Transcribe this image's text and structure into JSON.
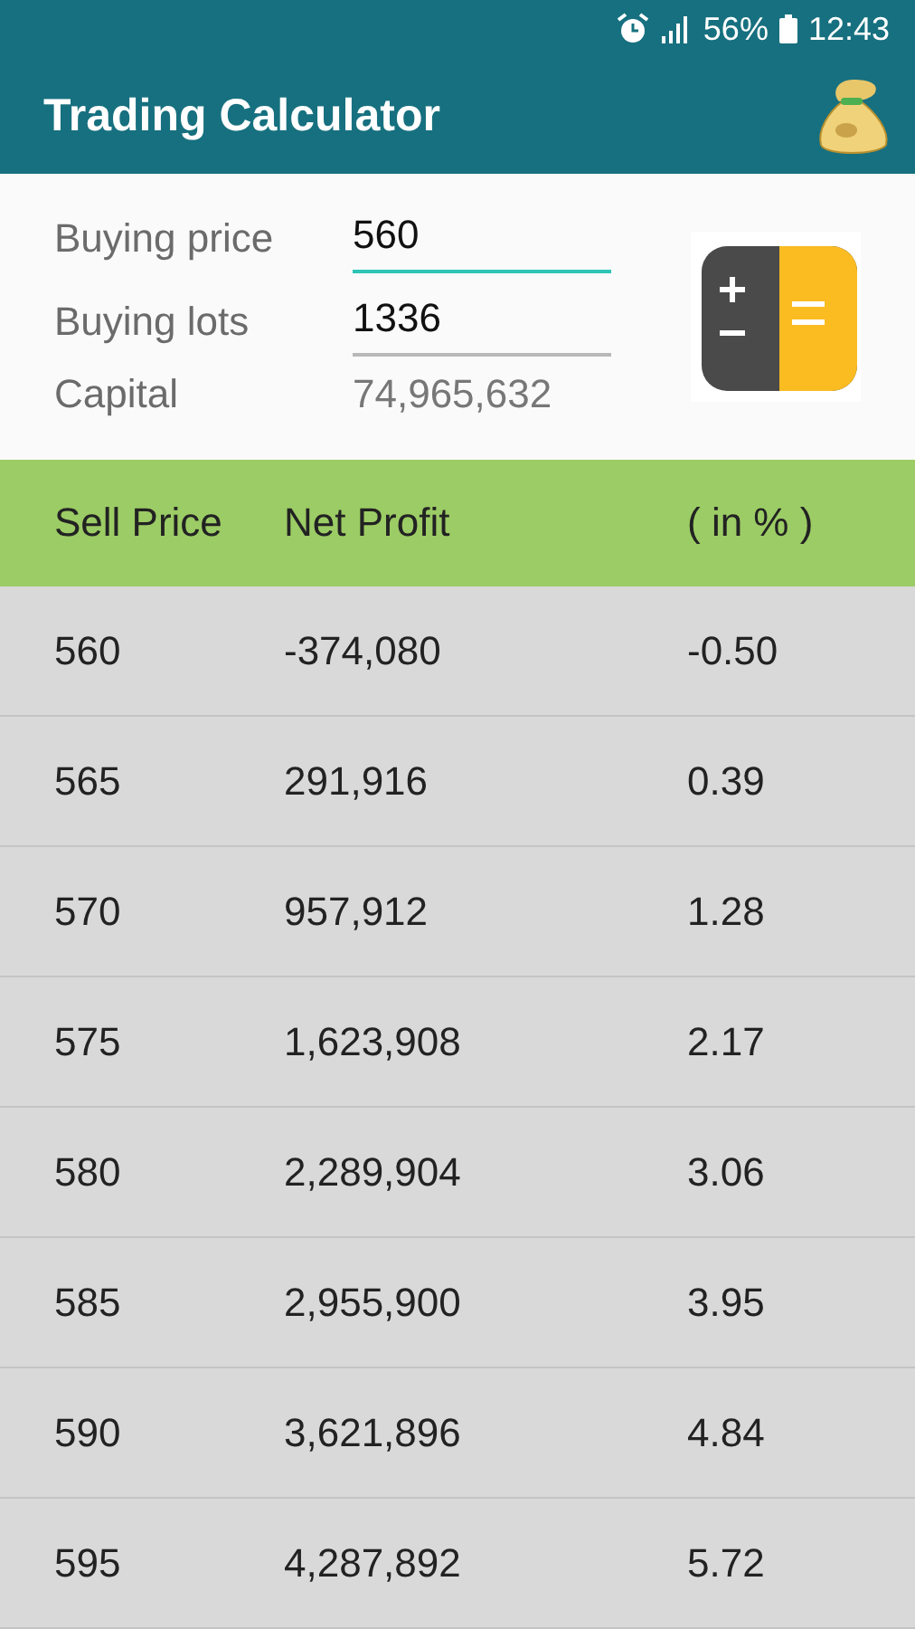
{
  "status_bar": {
    "battery": "56%",
    "time": "12:43"
  },
  "app_bar": {
    "title": "Trading Calculator"
  },
  "form": {
    "fields": [
      {
        "label": "Buying price",
        "value": "560",
        "focused": true
      },
      {
        "label": "Buying lots",
        "value": "1336",
        "focused": false
      }
    ],
    "capital": {
      "label": "Capital",
      "value": "74,965,632"
    }
  },
  "table": {
    "columns": [
      "Sell Price",
      "Net Profit",
      "( in % )"
    ],
    "rows": [
      [
        "560",
        "-374,080",
        "-0.50"
      ],
      [
        "565",
        "291,916",
        "0.39"
      ],
      [
        "570",
        "957,912",
        "1.28"
      ],
      [
        "575",
        "1,623,908",
        "2.17"
      ],
      [
        "580",
        "2,289,904",
        "3.06"
      ],
      [
        "585",
        "2,955,900",
        "3.95"
      ],
      [
        "590",
        "3,621,896",
        "4.84"
      ],
      [
        "595",
        "4,287,892",
        "5.72"
      ]
    ]
  }
}
